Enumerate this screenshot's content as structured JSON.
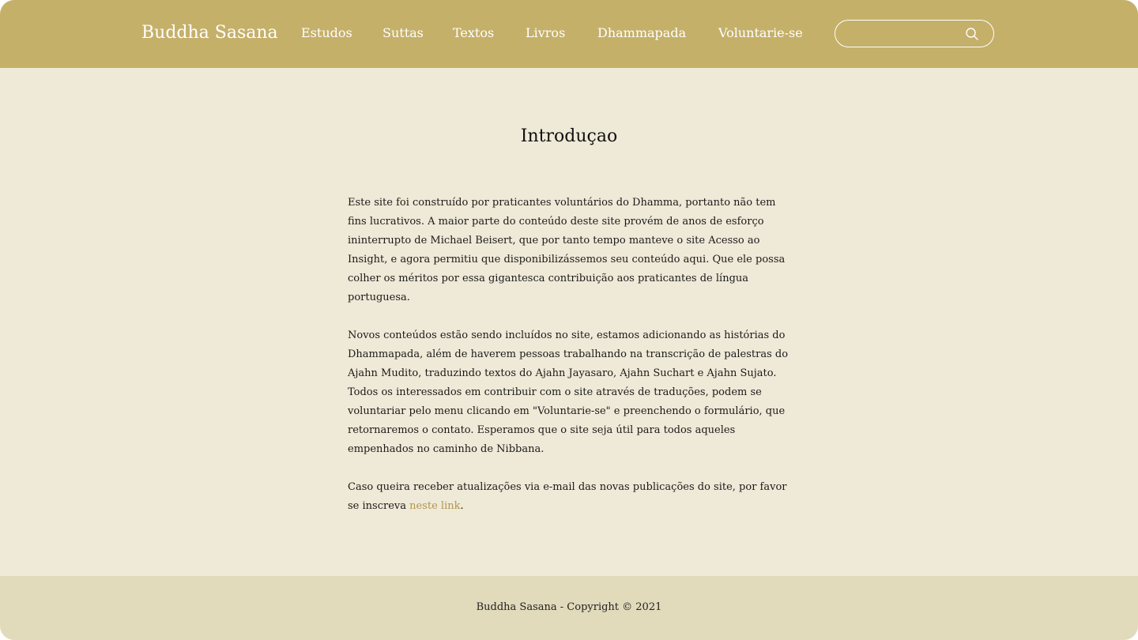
{
  "header": {
    "brand": "Buddha Sasana",
    "nav": [
      {
        "label": "Estudos"
      },
      {
        "label": "Suttas"
      },
      {
        "label": "Textos"
      },
      {
        "label": "Livros"
      },
      {
        "label": "Dhammapada"
      },
      {
        "label": "Voluntarie-se"
      }
    ],
    "search": {
      "value": "",
      "placeholder": ""
    }
  },
  "main": {
    "title": "Introduçao",
    "paragraphs": [
      "Este site foi construído por praticantes voluntários do Dhamma, portanto não tem fins lucrativos. A maior parte do conteúdo deste site provém de anos de esforço ininterrupto de Michael Beisert, que por tanto tempo manteve o site Acesso ao Insight, e agora permitiu que disponibilizássemos seu conteúdo aqui. Que ele possa colher os méritos por essa gigantesca contribuição aos praticantes de língua portuguesa.",
      "Novos conteúdos estão sendo incluídos no site, estamos adicionando as histórias do Dhammapada, além de haverem pessoas trabalhando na transcrição de palestras do Ajahn Mudito, traduzindo textos do Ajahn Jayasaro, Ajahn Suchart e Ajahn Sujato. Todos os interessados em contribuir com o site através de traduções, podem se voluntariar pelo menu clicando em \"Voluntarie-se\" e preenchendo o formulário, que retornaremos o contato. Esperamos que o site seja útil para todos aqueles empenhados no caminho de Nibbana."
    ],
    "subscribe": {
      "text": "Caso queira receber atualizações via e-mail das novas publicações do site, por favor se inscreva ",
      "link_label": "neste link",
      "suffix": "."
    }
  },
  "footer": {
    "text": "Buddha Sasana - Copyright © 2021"
  },
  "colors": {
    "header_bg": "#c5b06a",
    "page_bg": "#efe9d7",
    "footer_bg": "#e1dabb",
    "link": "#b0974e"
  },
  "icons": {
    "search": "search-icon"
  }
}
